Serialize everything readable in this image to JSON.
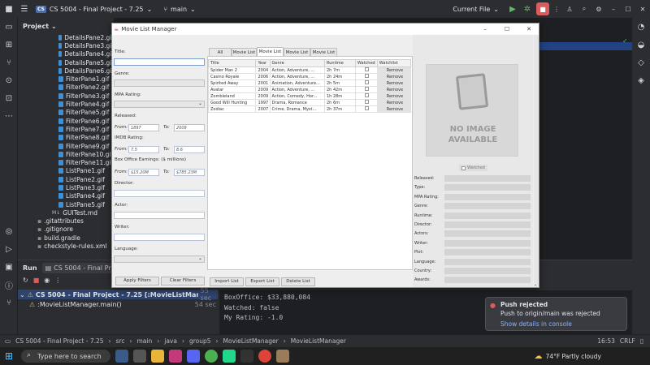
{
  "ide": {
    "project_badge": "CS",
    "project_name": "CS 5004 - Final Project - 7.25",
    "branch": "main",
    "run_config": "Current File",
    "project_panel_title": "Project"
  },
  "files": {
    "gifs": [
      "DetailsPane2.gif",
      "DetailsPane3.gif",
      "DetailsPane4.gif",
      "DetailsPane5.gif",
      "DetailsPane6.gif",
      "FilterPane1.gif",
      "FilterPane2.gif",
      "FilterPane3.gif",
      "FilterPane4.gif",
      "FilterPane5.gif",
      "FilterPane6.gif",
      "FilterPane7.gif",
      "FilterPane8.gif",
      "FilterPane9.gif",
      "FilterPane10.gif",
      "FilterPane11.gif",
      "ListPane1.gif",
      "ListPane2.gif",
      "ListPane3.gif",
      "ListPane4.gif",
      "ListPane5.gif"
    ],
    "gui_test": "GUITest.md",
    "others": [
      ".gitattributes",
      ".gitignore",
      "build.gradle",
      "checkstyle-rules.xml"
    ]
  },
  "run": {
    "tab_label": "Run",
    "config_label": "CS 5004 - Final Project - 7.25 [:MovieListManager.main()]",
    "item1": "CS 5004 - Final Project - 7.25 [:MovieListManager.main()]: B",
    "item1_time": "55 sec",
    "item2": ":MovieListManager.main()",
    "item2_time": "54 sec",
    "console_lines": [
      "BoxOffice: $33,880,084",
      "Watched: false",
      "My Rating: -1.0"
    ]
  },
  "notification": {
    "title": "Push rejected",
    "body": "Push to origin/main was rejected",
    "link": "Show details in console"
  },
  "statusbar": {
    "crumbs": [
      "CS 5004 - Final Project - 7.25",
      "src",
      "main",
      "java",
      "group5",
      "MovieListManager",
      "MovieListManager"
    ],
    "time": "16:53",
    "encoding": "CRLF"
  },
  "taskbar": {
    "search_placeholder": "Type here to search",
    "weather": "74°F  Partly cloudy"
  },
  "app": {
    "title": "Movie List Manager",
    "filter": {
      "title_label": "Title:",
      "genre_label": "Genre:",
      "mpa_label": "MPA Rating:",
      "released_label": "Released:",
      "from_label": "From:",
      "to_label": "To:",
      "released_from": "1897",
      "released_to": "2009",
      "imdb_label": "IMDB Rating:",
      "imdb_from": "7.5",
      "imdb_to": "8.6",
      "box_label": "Box Office Earnings: ($ millions)",
      "box_from": "$15.20M",
      "box_to": "$785.23M",
      "director_label": "Director:",
      "actor_label": "Actor:",
      "writer_label": "Writer:",
      "language_label": "Language:",
      "apply": "Apply Filters",
      "clear": "Clear Filters"
    },
    "tabs": [
      "All Movies",
      "Movie List 1",
      "Movie List 2",
      "Movie List 3",
      "Movie List 4"
    ],
    "selected_tab": "Movie List 2",
    "columns": [
      "Title",
      "Year",
      "Genre",
      "Runtime",
      "Watched",
      "Watchlist"
    ],
    "rows": [
      [
        "Spider Man 2",
        "2004",
        "Action, Adventure, ...",
        "2h 7m",
        "Remove"
      ],
      [
        "Casino Royale",
        "2006",
        "Action, Adventure, ...",
        "2h 24m",
        "Remove"
      ],
      [
        "Spirited Away",
        "2001",
        "Animation, Adventure...",
        "2h 5m",
        "Remove"
      ],
      [
        "Avatar",
        "2009",
        "Action, Adventure, ...",
        "2h 42m",
        "Remove"
      ],
      [
        "Zombieland",
        "2009",
        "Action, Comedy, Hor...",
        "1h 28m",
        "Remove"
      ],
      [
        "Good Will Hunting",
        "1997",
        "Drama, Romance",
        "2h 6m",
        "Remove"
      ],
      [
        "Zodiac",
        "2007",
        "Crime, Drama, Myst...",
        "2h 37m",
        "Remove"
      ]
    ],
    "list_buttons": [
      "Import List",
      "Export List",
      "Delete List"
    ],
    "no_image": [
      "NO IMAGE",
      "AVAILABLE"
    ],
    "watched_label": "Watched",
    "detail_labels": [
      "Released:",
      "Type:",
      "MPA Rating:",
      "Genre:",
      "Runtime:",
      "Director:",
      "Actors:",
      "Writer:",
      "Plot:",
      "Language:",
      "Country:",
      "Awards:"
    ]
  }
}
